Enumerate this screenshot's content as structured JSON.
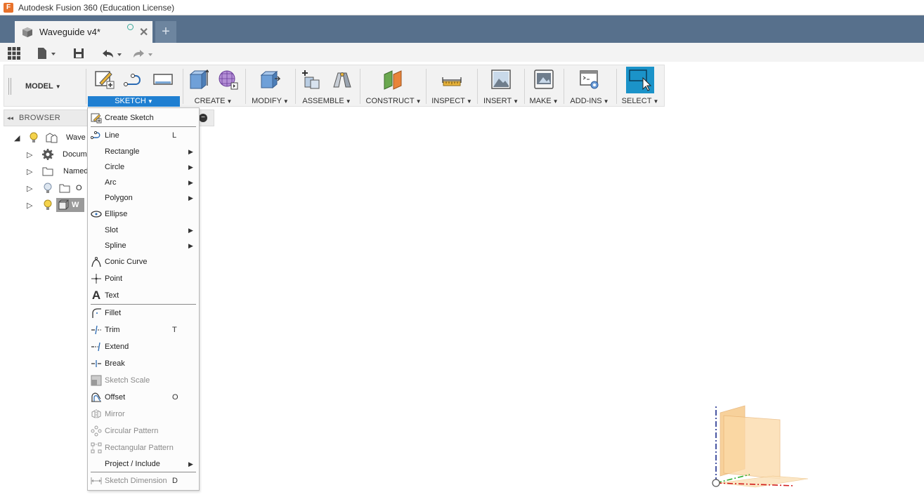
{
  "window": {
    "title": "Autodesk Fusion 360 (Education License)",
    "app_icon": "F"
  },
  "tabs": {
    "document_name": "Waveguide v4*",
    "new_tab_label": "+"
  },
  "toolbar": {
    "workspace": "MODEL",
    "groups": {
      "sketch": "SKETCH",
      "create": "CREATE",
      "modify": "MODIFY",
      "assemble": "ASSEMBLE",
      "construct": "CONSTRUCT",
      "inspect": "INSPECT",
      "insert": "INSERT",
      "make": "MAKE",
      "addins": "ADD-INS",
      "select": "SELECT"
    }
  },
  "browser": {
    "title": "BROWSER",
    "items": [
      {
        "label": "Wave",
        "icon": "component-icon"
      },
      {
        "label": "Docum",
        "icon": "gear-icon"
      },
      {
        "label": "Named",
        "icon": "folder-icon"
      },
      {
        "label": "O",
        "icon": "folder-icon"
      },
      {
        "label": "W",
        "icon": "body-icon"
      }
    ]
  },
  "sketch_menu": {
    "create_sketch": "Create Sketch",
    "line": "Line",
    "line_sc": "L",
    "rectangle": "Rectangle",
    "circle": "Circle",
    "arc": "Arc",
    "polygon": "Polygon",
    "ellipse": "Ellipse",
    "slot": "Slot",
    "spline": "Spline",
    "conic": "Conic Curve",
    "point": "Point",
    "text": "Text",
    "fillet": "Fillet",
    "trim": "Trim",
    "trim_sc": "T",
    "extend": "Extend",
    "break": "Break",
    "scale": "Sketch Scale",
    "offset": "Offset",
    "offset_sc": "O",
    "mirror": "Mirror",
    "circ_pattern": "Circular Pattern",
    "rect_pattern": "Rectangular Pattern",
    "project": "Project / Include",
    "dimension": "Sketch Dimension",
    "dimension_sc": "D"
  },
  "colors": {
    "tabstrip": "#57708c",
    "accent": "#1f7fd1",
    "select_button": "#1b93c9"
  }
}
